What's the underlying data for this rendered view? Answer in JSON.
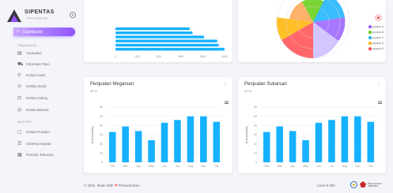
{
  "brand": {
    "name": "SIPENTAS",
    "subtitle": "Sistem Penjualan Aset"
  },
  "sidebar": {
    "active": {
      "icon": "home-icon",
      "label": "Dashboard"
    },
    "sections": [
      {
        "head": "TRANSAKSI",
        "items": [
          {
            "icon": "receipt-icon",
            "label": "Transaksi"
          },
          {
            "icon": "truck-icon",
            "label": "Informasi Toko"
          },
          {
            "icon": "user-icon",
            "label": "Kelola Kasir"
          },
          {
            "icon": "store-icon",
            "label": "Kelola Stock"
          },
          {
            "icon": "gallery-icon",
            "label": "Kelola Galery"
          },
          {
            "icon": "banner-icon",
            "label": "Kelola Banner"
          }
        ]
      },
      {
        "head": "MASTER",
        "items": [
          {
            "icon": "box-icon",
            "label": "Kelola Product"
          },
          {
            "icon": "list-icon",
            "label": "Ordered Masuk"
          },
          {
            "icon": "calendar-icon",
            "label": "Periode Tahunan"
          }
        ]
      }
    ]
  },
  "top_left_chart": {
    "type": "bar",
    "orientation": "horizontal",
    "categories": [
      "",
      "",
      "",
      "",
      "",
      ""
    ],
    "values": [
      1020,
      1060,
      1220,
      1400,
      1420,
      1620
    ],
    "x_ticks": [
      "0",
      "300",
      "600",
      "900",
      "1200",
      "1500"
    ],
    "xlim": [
      0,
      1500
    ]
  },
  "top_right_legend": [
    {
      "label": "produk A",
      "color": "#9155fd"
    },
    {
      "label": "produk B",
      "color": "#56ca00"
    },
    {
      "label": "produk C",
      "color": "#16b1ff"
    },
    {
      "label": "produk D",
      "color": "#ffb400"
    },
    {
      "label": "produk E",
      "color": "#ff4c51"
    }
  ],
  "cards": [
    {
      "title": "Penjualan Megarsari",
      "sub": "30 %"
    },
    {
      "title": "Penjualan Sukarsari",
      "sub": "30 %"
    }
  ],
  "chart_data": [
    {
      "type": "bar",
      "title": "Penjualan Megarsari",
      "ylabel": "$ (thousands)",
      "categories": [
        "Feb",
        "Mar",
        "Apr",
        "May",
        "Jun",
        "Jul",
        "Aug",
        "Sep",
        "Oct"
      ],
      "values": [
        33,
        39,
        34,
        24,
        43,
        46,
        50,
        50,
        44
      ],
      "yticks": [
        "0",
        "10",
        "20",
        "30",
        "40",
        "50",
        "60"
      ],
      "ylim": [
        0,
        60
      ]
    },
    {
      "type": "bar",
      "title": "Penjualan Sukarsari",
      "ylabel": "$ (thousands)",
      "categories": [
        "Feb",
        "Mar",
        "Apr",
        "May",
        "Jun",
        "Jul",
        "Aug",
        "Sep",
        "Oct"
      ],
      "values": [
        33,
        39,
        34,
        24,
        43,
        46,
        50,
        50,
        44
      ],
      "yticks": [
        "0",
        "10",
        "20",
        "30",
        "40",
        "50",
        "60"
      ],
      "ylim": [
        0,
        60
      ]
    }
  ],
  "footer": {
    "left_prefix": "© 2021, Made With",
    "left_suffix": "Pemuda Baru",
    "right": "Level 9.350",
    "logo_text_1": "Dinas Koperasi",
    "logo_text_2": "UMKM Ppn"
  },
  "colors": {
    "accent": "#9155fd",
    "bar": "#16b1ff",
    "grid": "#e7e7ef"
  }
}
